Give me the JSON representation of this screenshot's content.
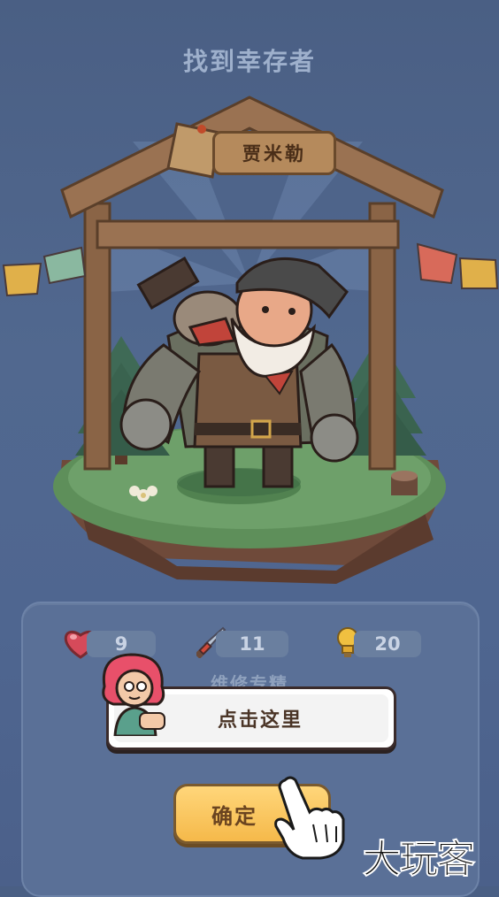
{
  "screen": {
    "title": "找到幸存者"
  },
  "survivor": {
    "name": "贾米勒",
    "skill": "维修专精"
  },
  "stats": {
    "health": "9",
    "attack": "11",
    "resource": "20"
  },
  "tutorial": {
    "hint_text": "点击这里"
  },
  "buttons": {
    "confirm_label": "确定"
  },
  "watermark": {
    "text": "大玩客"
  },
  "colors": {
    "background": "#4f6690",
    "panel": "#5a7097",
    "confirm_button": "#f5b94a",
    "heart": "#d64a5a"
  }
}
